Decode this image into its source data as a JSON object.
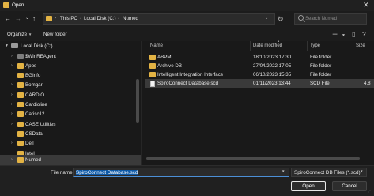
{
  "window": {
    "title": "Open"
  },
  "nav": {
    "back": "←",
    "forward": "→",
    "up_chevron": "⌄",
    "up": "↑"
  },
  "address": {
    "crumbs": [
      "This PC",
      "Local Disk (C:)",
      "Numed"
    ],
    "separator": "›"
  },
  "search": {
    "placeholder": "Search Numed"
  },
  "toolbar": {
    "organize": "Organize",
    "new_folder": "New folder"
  },
  "sidebar": {
    "items": [
      {
        "label": "Local Disk (C:)",
        "icon": "drive-icon",
        "expanded": true
      },
      {
        "label": "$WinREAgent",
        "icon": "folder-icon-gray"
      },
      {
        "label": "Apps",
        "icon": "folder-icon"
      },
      {
        "label": "BGInfo",
        "icon": "folder-icon"
      },
      {
        "label": "Bomgar",
        "icon": "folder-icon"
      },
      {
        "label": "CARDIO",
        "icon": "folder-icon"
      },
      {
        "label": "Cardioline",
        "icon": "folder-icon"
      },
      {
        "label": "Carisc12",
        "icon": "folder-icon"
      },
      {
        "label": "CASE Utilities",
        "icon": "folder-icon"
      },
      {
        "label": "CSData",
        "icon": "folder-icon"
      },
      {
        "label": "Dell",
        "icon": "folder-icon"
      },
      {
        "label": "Intel",
        "icon": "folder-icon"
      },
      {
        "label": "Numed",
        "icon": "folder-icon",
        "selected": true
      }
    ]
  },
  "columns": {
    "name": "Name",
    "date": "Date modified",
    "type": "Type",
    "size": "Size"
  },
  "files": [
    {
      "name": "ABPM",
      "date": "18/10/2023 17:30",
      "type": "File folder",
      "size": "",
      "icon": "folder-icon"
    },
    {
      "name": "Archive DB",
      "date": "27/04/2022 17:05",
      "type": "File folder",
      "size": "",
      "icon": "folder-icon"
    },
    {
      "name": "Intelligent Integration Interface",
      "date": "06/10/2023 15:35",
      "type": "File folder",
      "size": "",
      "icon": "folder-icon"
    },
    {
      "name": "SpiroConnect Database.scd",
      "date": "01/11/2023 13:44",
      "type": "SCD File",
      "size": "4,8",
      "icon": "document-icon",
      "selected": true
    }
  ],
  "bottom": {
    "file_name_label": "File name:",
    "file_name_value": "SpiroConnect Database.scd",
    "file_type": "SpiroConnect DB Files (*.scd)",
    "open_label": "Open",
    "cancel_label": "Cancel"
  },
  "colors": {
    "background": "#1c1c1c",
    "folder": "#e3b344",
    "selection": "#3a3a3a",
    "input_focus": "#4c8fd6"
  }
}
